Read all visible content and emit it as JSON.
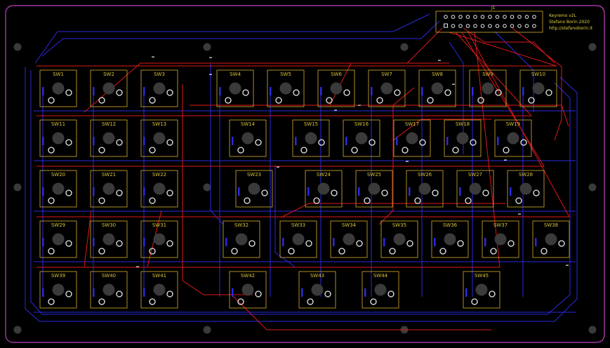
{
  "board": {
    "connector_label": "J1",
    "info_lines": [
      "Keyremo v2L",
      "Stefano Borin 2020",
      "http://stefanoborin.it"
    ]
  },
  "colors": {
    "background": "#000000",
    "outline": "#c040c0",
    "top_trace": "#e01818",
    "bottom_trace": "#2a2ae0",
    "silkscreen": "#d8b030",
    "pad": "#e8e8e8",
    "mount_hole": "#3a3a3a"
  },
  "rows": [
    [
      "SW1",
      "SW2",
      "SW3",
      "SW4",
      "SW5",
      "SW6",
      "SW7",
      "SW8",
      "SW9",
      "SW10"
    ],
    [
      "SW11",
      "SW12",
      "SW13",
      "SW14",
      "SW15",
      "SW16",
      "SW17",
      "SW18",
      "SW19"
    ],
    [
      "SW20",
      "SW21",
      "SW22",
      "SW23",
      "SW24",
      "SW25",
      "SW26",
      "SW27",
      "SW28"
    ],
    [
      "SW29",
      "SW30",
      "SW31",
      "SW32",
      "SW33",
      "SW34",
      "SW35",
      "SW36",
      "SW37",
      "SW38"
    ],
    [
      "SW39",
      "SW40",
      "SW41",
      "SW42",
      "SW43",
      "SW44",
      "SW45"
    ]
  ]
}
